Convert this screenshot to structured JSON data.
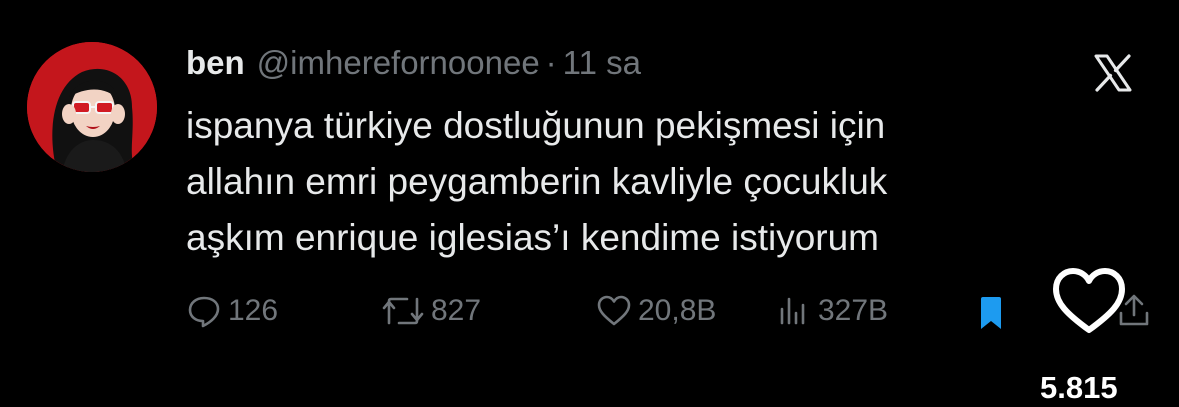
{
  "tweet": {
    "author": {
      "display_name": "ben",
      "handle": "@imherefornoonee",
      "separator": "·",
      "time": "11 sa",
      "avatar_icon": "avatar-illustration-icon"
    },
    "brand_icon": "x-logo-icon",
    "text_lines": [
      "ispanya türkiye dostluğunun pekişmesi için",
      "allahın emri peygamberin kavliyle çocukluk",
      "aşkım enrique iglesias’ı kendime istiyorum"
    ],
    "actions": {
      "replies": {
        "icon": "reply-icon",
        "count": "126"
      },
      "retweets": {
        "icon": "retweet-icon",
        "count": "827"
      },
      "likes": {
        "icon": "heart-icon",
        "count": "20,8B"
      },
      "views": {
        "icon": "views-icon",
        "count": "327B"
      },
      "bookmark": {
        "icon": "bookmark-icon",
        "color": "#1d9bf0"
      },
      "share": {
        "icon": "share-icon"
      }
    }
  },
  "overlay": {
    "heart_icon": "heart-outline-icon",
    "like_count": "5.815"
  },
  "colors": {
    "background": "#000000",
    "text": "#e7e9ea",
    "muted": "#71767b",
    "accent": "#1d9bf0"
  }
}
